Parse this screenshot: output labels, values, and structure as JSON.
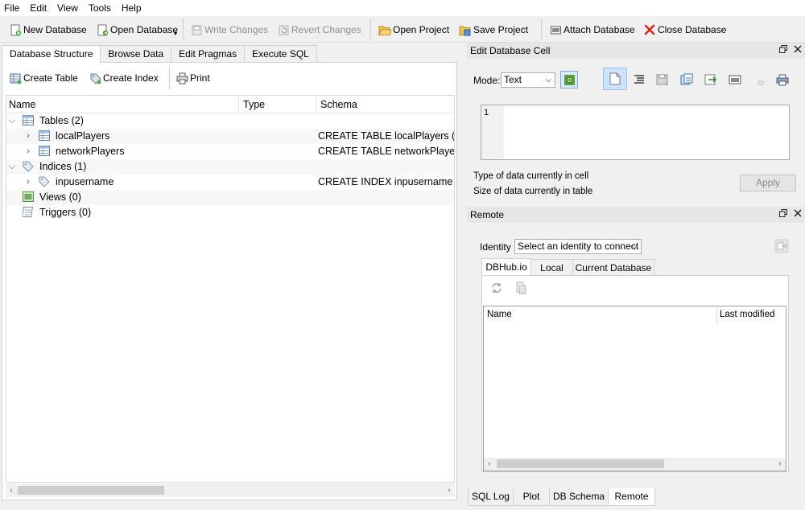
{
  "menu": [
    "File",
    "Edit",
    "View",
    "Tools",
    "Help"
  ],
  "toolbar": {
    "new_database": "New Database",
    "open_database": "Open Database",
    "write_changes": "Write Changes",
    "revert_changes": "Revert Changes",
    "open_project": "Open Project",
    "save_project": "Save Project",
    "attach_database": "Attach Database",
    "close_database": "Close Database"
  },
  "left_tabs": [
    "Database Structure",
    "Browse Data",
    "Edit Pragmas",
    "Execute SQL"
  ],
  "structure_toolbar": {
    "create_table": "Create Table",
    "create_index": "Create Index",
    "print": "Print"
  },
  "tree": {
    "columns": [
      "Name",
      "Type",
      "Schema"
    ],
    "rows": [
      {
        "label": "Tables (2)",
        "schema": ""
      },
      {
        "label": "localPlayers",
        "schema": "CREATE TABLE localPlayers (id"
      },
      {
        "label": "networkPlayers",
        "schema": "CREATE TABLE networkPlayers"
      },
      {
        "label": "Indices (1)",
        "schema": ""
      },
      {
        "label": "inpusername",
        "schema": "CREATE INDEX inpusername O"
      },
      {
        "label": "Views (0)",
        "schema": ""
      },
      {
        "label": "Triggers (0)",
        "schema": ""
      }
    ]
  },
  "edit_cell": {
    "title": "Edit Database Cell",
    "mode_label": "Mode:",
    "mode_value": "Text",
    "line_number": "1",
    "type_info": "Type of data currently in cell",
    "size_info": "Size of data currently in table",
    "apply": "Apply"
  },
  "remote": {
    "title": "Remote",
    "identity_label": "Identity",
    "identity_value": "Select an identity to connect",
    "tabs": [
      "DBHub.io",
      "Local",
      "Current Database"
    ],
    "columns": [
      "Name",
      "Last modified"
    ]
  },
  "bottom_tabs": [
    "SQL Log",
    "Plot",
    "DB Schema",
    "Remote"
  ],
  "colors": {
    "accent_blue": "#2e6fbd",
    "close_red": "#d9261c",
    "selected_button": "#cfe3f7"
  }
}
